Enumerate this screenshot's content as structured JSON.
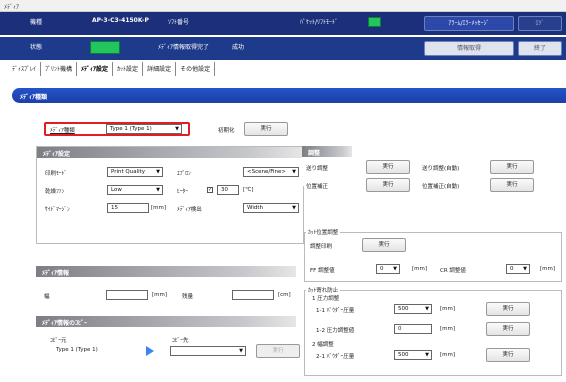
{
  "window": {
    "title": "ﾒﾃﾞｨｱ"
  },
  "header": {
    "row1": {
      "model_label": "機種",
      "model_value": "AP-3-C3-4150K-P",
      "version_label": "ｿﾌﾄ番号",
      "version_value": "",
      "packet_label": "ﾊﾟｹｯﾄ/ﾘﾌﾄﾓｰﾄﾞ",
      "packet_value": "",
      "message_btn": "ｱﾗｰﾑ/ｴﾗｰﾒｯｾｰｼﾞ",
      "right_btn": "ﾛｸﾞ"
    },
    "row2": {
      "status_label": "状態",
      "status_text": "ﾒﾃﾞｨｱ情報取得完了",
      "status_result": "成功",
      "mode_btn": "情報取得",
      "end_btn": "終了"
    }
  },
  "tabs": [
    "ﾃﾞｨｽﾌﾟﾚｲ",
    "ﾌﾟﾘﾝﾄ機構",
    "ﾒﾃﾞｨｱ設定",
    "ｶｯﾄ設定",
    "詳細設定",
    "その他設定"
  ],
  "active_tab": 2,
  "section": {
    "title": "ﾒﾃﾞｨｱ種類"
  },
  "media_type": {
    "label": "ﾒﾃﾞｨｱ種類",
    "value": "Type 1 (Type 1)",
    "init_label": "初期化",
    "run": "実行"
  },
  "media_settings": {
    "title": "ﾒﾃﾞｨｱ設定",
    "print_mode_label": "印刷ﾓｰﾄﾞ",
    "print_mode_value": "Print Quality",
    "dry_fan_label": "乾燥ﾌｧﾝ",
    "dry_fan_value": "Low",
    "cutter_label": "ｻｲﾄﾞﾏｰｼﾞﾝ",
    "cutter_value": "15",
    "cutter_unit": "[mm]",
    "collect_label": "ｴﾌﾟﾛﾝ",
    "collect_value": "<Scene/Fine>",
    "heater_label": "ﾋｰﾀｰ",
    "heater_value": "30",
    "heater_unit": "[℃]",
    "media_detect_label": "ﾒﾃﾞｨｱ検出",
    "media_detect_value": "Width"
  },
  "adjust": {
    "title": "調整",
    "rows": [
      {
        "left": "送り調整",
        "left_btn": "実行",
        "right": "送り調整(自動)",
        "right_btn": "実行"
      },
      {
        "left": "位置補正",
        "left_btn": "実行",
        "right": "位置補正(自動)",
        "right_btn": "実行"
      }
    ]
  },
  "cut_position": {
    "title": "ｶｯﾄ位置調整",
    "adjust_label": "調整印刷",
    "adjust_btn": "実行",
    "ff_label": "FF 調整値",
    "ff_value": "0",
    "ff_unit": "[mm]",
    "cr_label": "CR 調整値",
    "cr_value": "0",
    "cr_unit": "[mm]"
  },
  "cut_prevent": {
    "title": "ｶｯﾄ寄れ防止",
    "g1_title": "1 圧力調整",
    "r11_label": "1-1 ﾊﾟｳﾀﾞｰ圧量",
    "r11_value": "500",
    "r11_unit": "[mm]",
    "r11_btn": "実行",
    "r12_label": "1-2 圧力調整値",
    "r12_value": "0",
    "r12_unit": "[mm]",
    "r12_btn": "実行",
    "g2_title": "2 幅調整",
    "r21_label": "2-1 ﾊﾟｳﾀﾞｰ圧量",
    "r21_value": "500",
    "r21_unit": "[mm]",
    "r21_btn": "実行"
  },
  "media_info": {
    "title": "ﾒﾃﾞｨｱ情報",
    "width_label": "幅",
    "width_value": "",
    "width_unit": "[mm]",
    "remain_label": "残量",
    "remain_value": "",
    "remain_unit": "[cm]"
  },
  "media_copy": {
    "title": "ﾒﾃﾞｨｱ情報のｺﾋﾟｰ",
    "from_label": "ｺﾋﾟｰ元",
    "from_value": "Type 1 (Type 1)",
    "to_label": "ｺﾋﾟｰ先",
    "to_value": "",
    "run": "実行"
  },
  "colors": {
    "header": "#1b2f7a",
    "accent": "#2453c9",
    "status_led": "#22c55e",
    "highlight": "#e11d25"
  }
}
